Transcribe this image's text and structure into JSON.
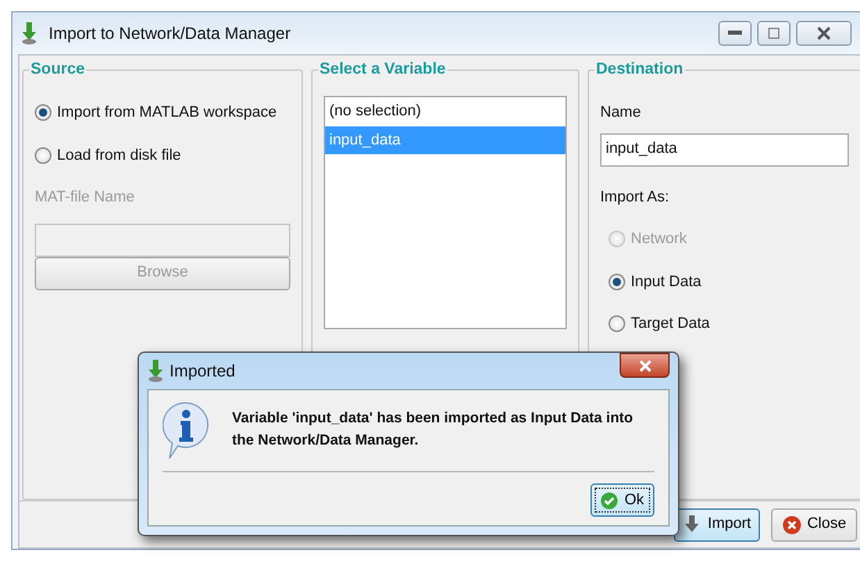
{
  "window": {
    "title": "Import to Network/Data Manager"
  },
  "source": {
    "title": "Source",
    "options": [
      {
        "label": "Import from MATLAB workspace",
        "selected": true,
        "disabled": false
      },
      {
        "label": "Load from disk file",
        "selected": false,
        "disabled": false
      }
    ],
    "file_label": "MAT-file Name",
    "browse_button": {
      "label": "Browse",
      "disabled": true
    }
  },
  "variable": {
    "title": "Select a Variable",
    "items": [
      {
        "label": "(no selection)",
        "selected": false
      },
      {
        "label": "input_data",
        "selected": true
      }
    ]
  },
  "destination": {
    "title": "Destination",
    "name_label": "Name",
    "name_value": "input_data",
    "import_as_label": "Import As:",
    "options": [
      {
        "label": "Network",
        "selected": false,
        "disabled": true
      },
      {
        "label": "Input Data",
        "selected": true,
        "disabled": false
      },
      {
        "label": "Target Data",
        "selected": false,
        "disabled": false
      }
    ]
  },
  "buttons": [
    {
      "label": "Import",
      "kind": "import",
      "focused": true
    },
    {
      "label": "Close",
      "kind": "close",
      "focused": false
    }
  ],
  "dialog": {
    "title": "Imported",
    "message": "Variable 'input_data' has been imported as Input Data into the Network/Data Manager.",
    "button": "Ok"
  }
}
